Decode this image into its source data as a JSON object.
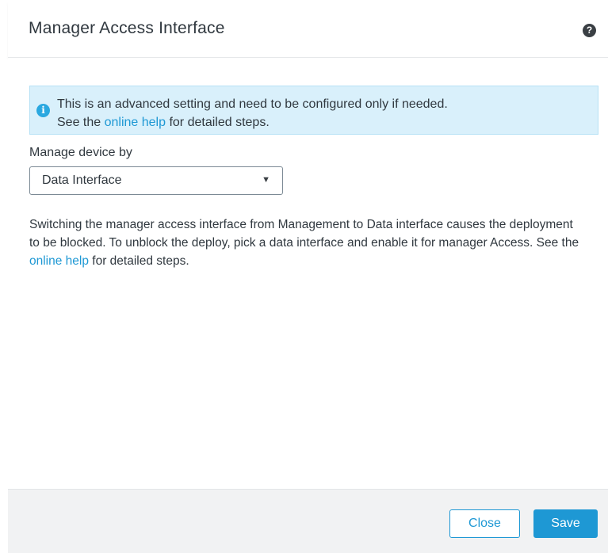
{
  "dialog": {
    "title": "Manager Access Interface",
    "help_icon": "?"
  },
  "info": {
    "icon": "i",
    "line1": "This is an advanced setting and need to be configured only if needed.",
    "line2_prefix": "See the ",
    "line2_link": "online help",
    "line2_suffix": " for detailed steps."
  },
  "form": {
    "manage_label": "Manage device by",
    "manage_value": "Data Interface",
    "caret": "▼"
  },
  "description": {
    "text": "Switching the manager access interface from Management to Data interface causes the deployment to be blocked. To unblock the deploy, pick a data interface and enable it for manager Access. See the ",
    "link": "online help",
    "suffix": " for detailed steps."
  },
  "footer": {
    "close_label": "Close",
    "save_label": "Save"
  },
  "colors": {
    "accent": "#1e98d4",
    "info_bg": "#d9f0fb",
    "footer_bg": "#f1f2f3"
  }
}
